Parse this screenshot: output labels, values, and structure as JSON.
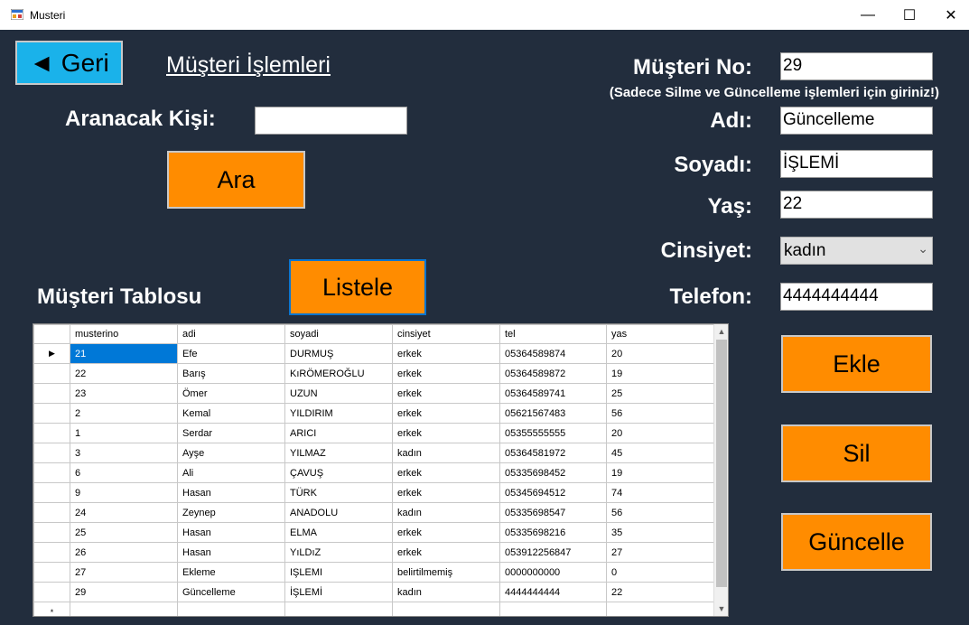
{
  "window": {
    "title": "Musteri",
    "controls": {
      "minimize": "—",
      "maximize": "☐",
      "close": "✕"
    }
  },
  "header": {
    "back_label": "◄ Geri",
    "title": "Müşteri İşlemleri"
  },
  "search": {
    "label": "Aranacak Kişi:",
    "value": "",
    "button": "Ara"
  },
  "table_section": {
    "label": "Müşteri Tablosu",
    "list_button": "Listele"
  },
  "form": {
    "no_label": "Müşteri No:",
    "no_value": "29",
    "hint": "(Sadece Silme ve Güncelleme işlemleri için giriniz!)",
    "name_label": "Adı:",
    "name_value": "Güncelleme",
    "surname_label": "Soyadı:",
    "surname_value": "İŞLEMİ",
    "age_label": "Yaş:",
    "age_value": "22",
    "gender_label": "Cinsiyet:",
    "gender_value": "kadın",
    "phone_label": "Telefon:",
    "phone_value": "4444444444"
  },
  "actions": {
    "add": "Ekle",
    "delete": "Sil",
    "update": "Güncelle"
  },
  "grid": {
    "columns": [
      "musterino",
      "adi",
      "soyadi",
      "cinsiyet",
      "tel",
      "yas"
    ],
    "rows": [
      [
        "21",
        "Efe",
        "DURMUŞ",
        "erkek",
        "05364589874",
        "20"
      ],
      [
        "22",
        "Barış",
        "KıRÖMEROĞLU",
        "erkek",
        "05364589872",
        "19"
      ],
      [
        "23",
        "Ömer",
        "UZUN",
        "erkek",
        "05364589741",
        "25"
      ],
      [
        "2",
        "Kemal",
        "YILDIRIM",
        "erkek",
        "05621567483",
        "56"
      ],
      [
        "1",
        "Serdar",
        "ARICI",
        "erkek",
        "05355555555",
        "20"
      ],
      [
        "3",
        "Ayşe",
        "YILMAZ",
        "kadın",
        "05364581972",
        "45"
      ],
      [
        "6",
        "Ali",
        "ÇAVUŞ",
        "erkek",
        "05335698452",
        "19"
      ],
      [
        "9",
        "Hasan",
        "TÜRK",
        "erkek",
        "05345694512",
        "74"
      ],
      [
        "24",
        "Zeynep",
        "ANADOLU",
        "kadın",
        "05335698547",
        "56"
      ],
      [
        "25",
        "Hasan",
        "ELMA",
        "erkek",
        "05335698216",
        "35"
      ],
      [
        "26",
        "Hasan",
        "YıLDıZ",
        "erkek",
        "053912256847",
        "27"
      ],
      [
        "27",
        "Ekleme",
        "IŞLEMI",
        "belirtilmemiş",
        "0000000000",
        "0"
      ],
      [
        "29",
        "Güncelleme",
        "İŞLEMİ",
        "kadın",
        "4444444444",
        "22"
      ]
    ],
    "current_row_glyph": "▶",
    "new_row_glyph": "*"
  },
  "colors": {
    "background": "#222d3d",
    "accent_orange": "#ff8c00",
    "back_button_blue": "#1ab2ea",
    "selection_blue": "#0078d7"
  }
}
